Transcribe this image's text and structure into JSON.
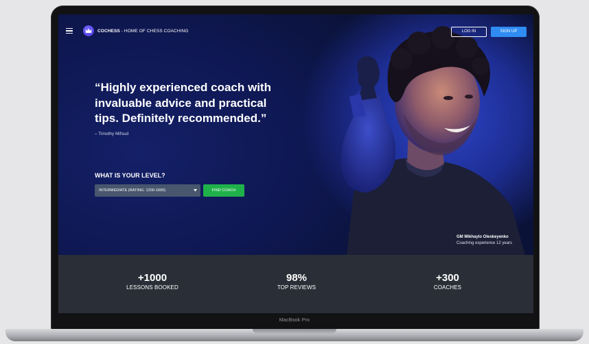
{
  "nav": {
    "brand_name": "COCHESS",
    "brand_tagline": " - HOME OF CHESS COACHING",
    "login_label": "LOG IN",
    "signup_label": "SIGN UP"
  },
  "hero": {
    "quote": "“Highly experienced coach with invaluable advice and practical tips. Definitely recommended.”",
    "quote_author": "– Timothy Mifsud",
    "level_label": "WHAT IS YOUR LEVEL?",
    "level_selected": "INTERMEDIATE (RATING: 1200-1600)",
    "find_label": "FIND COACH",
    "coach_name": "GM Mikhaylo Oleskeyenko",
    "coach_experience": "Coaching experience 12 years"
  },
  "stats": [
    {
      "value": "+1000",
      "label": "LESSONS BOOKED"
    },
    {
      "value": "98%",
      "label": "TOP REVIEWS"
    },
    {
      "value": "+300",
      "label": "COACHES"
    }
  ],
  "device_label": "MacBook Pro",
  "colors": {
    "accent_blue": "#2f8cf2",
    "find_green": "#20b24a",
    "hero_bg": "#1d2d92",
    "stats_bg": "#2a2f37"
  },
  "icons": {
    "menu": "hamburger-icon",
    "logo": "crown-icon",
    "select": "caret-down-icon"
  }
}
